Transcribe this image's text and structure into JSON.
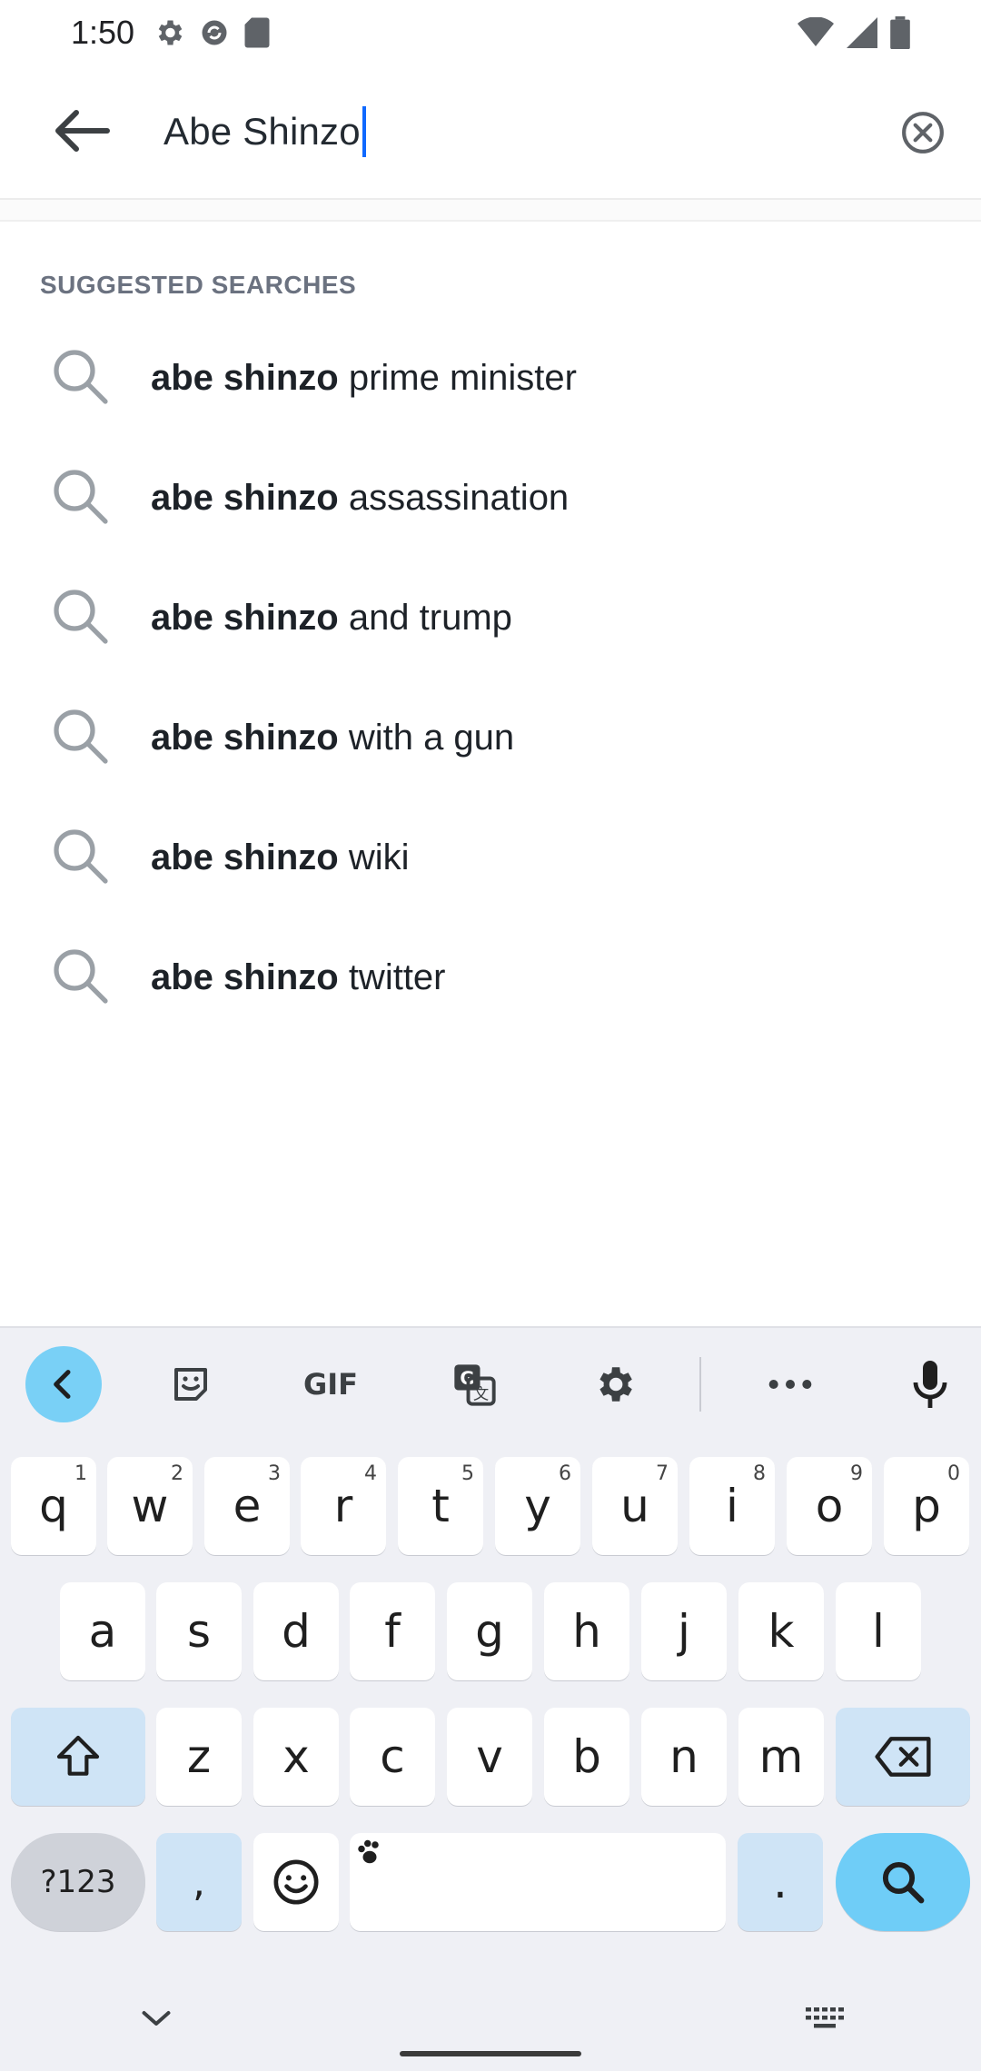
{
  "status_bar": {
    "time": "1:50",
    "left_icons": [
      "settings-icon",
      "sync-icon",
      "sd-card-icon"
    ],
    "right_icons": [
      "wifi-icon",
      "signal-icon",
      "battery-icon"
    ]
  },
  "search": {
    "value": "Abe Shinzo",
    "back_icon": "arrow-left-icon",
    "clear_icon": "clear-circle-icon"
  },
  "suggestions": {
    "title": "SUGGESTED SEARCHES",
    "items": [
      {
        "bold": "abe shinzo",
        "rest": " prime minister"
      },
      {
        "bold": "abe shinzo",
        "rest": " assassination"
      },
      {
        "bold": "abe shinzo",
        "rest": " and trump"
      },
      {
        "bold": "abe shinzo",
        "rest": " with a gun"
      },
      {
        "bold": "abe shinzo",
        "rest": " wiki"
      },
      {
        "bold": "abe shinzo",
        "rest": " twitter"
      }
    ]
  },
  "keyboard": {
    "toolbar": [
      "back-icon",
      "sticker-icon",
      "gif-icon",
      "translate-icon",
      "settings-icon",
      "more-icon",
      "mic-icon"
    ],
    "gif_label": "GIF",
    "row1": [
      {
        "k": "q",
        "h": "1"
      },
      {
        "k": "w",
        "h": "2"
      },
      {
        "k": "e",
        "h": "3"
      },
      {
        "k": "r",
        "h": "4"
      },
      {
        "k": "t",
        "h": "5"
      },
      {
        "k": "y",
        "h": "6"
      },
      {
        "k": "u",
        "h": "7"
      },
      {
        "k": "i",
        "h": "8"
      },
      {
        "k": "o",
        "h": "9"
      },
      {
        "k": "p",
        "h": "0"
      }
    ],
    "row2": [
      "a",
      "s",
      "d",
      "f",
      "g",
      "h",
      "j",
      "k",
      "l"
    ],
    "row3": [
      "z",
      "x",
      "c",
      "v",
      "b",
      "n",
      "m"
    ],
    "sym_label": "?123",
    "comma": ",",
    "period": "."
  }
}
